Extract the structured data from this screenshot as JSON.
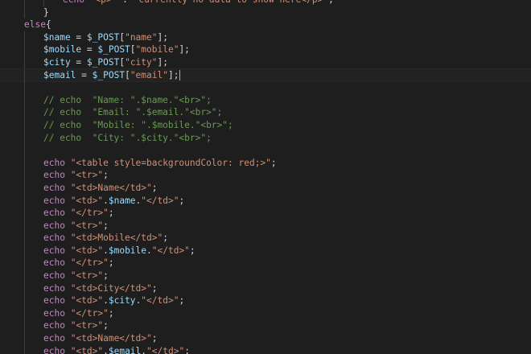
{
  "editor": {
    "current_line": 5,
    "lines": [
      {
        "indent": 2,
        "tokens": [
          [
            "kw",
            "echo "
          ],
          [
            "str",
            "\"<p>\""
          ],
          [
            "op",
            " . "
          ],
          [
            "str",
            "\"currently no data to show here</p>\""
          ],
          [
            "op",
            ";"
          ]
        ]
      },
      {
        "indent": 1,
        "tokens": [
          [
            "op",
            "}"
          ]
        ]
      },
      {
        "indent": 0,
        "tokens": [
          [
            "kw",
            "else"
          ],
          [
            "op",
            "{"
          ]
        ]
      },
      {
        "indent": 1,
        "tokens": [
          [
            "var",
            "$name"
          ],
          [
            "op",
            " = "
          ],
          [
            "var",
            "$_POST"
          ],
          [
            "op",
            "["
          ],
          [
            "str",
            "\"name\""
          ],
          [
            "op",
            "];"
          ]
        ]
      },
      {
        "indent": 1,
        "tokens": [
          [
            "var",
            "$mobile"
          ],
          [
            "op",
            " = "
          ],
          [
            "var",
            "$_POST"
          ],
          [
            "op",
            "["
          ],
          [
            "str",
            "\"mobile\""
          ],
          [
            "op",
            "];"
          ]
        ]
      },
      {
        "indent": 1,
        "tokens": [
          [
            "var",
            "$city"
          ],
          [
            "op",
            " = "
          ],
          [
            "var",
            "$_POST"
          ],
          [
            "op",
            "["
          ],
          [
            "str",
            "\"city\""
          ],
          [
            "op",
            "];"
          ]
        ]
      },
      {
        "indent": 1,
        "tokens": [
          [
            "var",
            "$email"
          ],
          [
            "op",
            " = "
          ],
          [
            "var",
            "$_POST"
          ],
          [
            "op",
            "["
          ],
          [
            "str",
            "\"email\""
          ],
          [
            "op",
            "];"
          ]
        ],
        "caret": true
      },
      {
        "indent": 1,
        "tokens": []
      },
      {
        "indent": 1,
        "tokens": [
          [
            "cm",
            "// echo  \"Name: \".$name.\"<br>\";"
          ]
        ]
      },
      {
        "indent": 1,
        "tokens": [
          [
            "cm",
            "// echo  \"Email: \".$email.\"<br>\";"
          ]
        ]
      },
      {
        "indent": 1,
        "tokens": [
          [
            "cm",
            "// echo  \"Mobile: \".$mobile.\"<br>\";"
          ]
        ]
      },
      {
        "indent": 1,
        "tokens": [
          [
            "cm",
            "// echo  \"City: \".$city.\"<br>\";"
          ]
        ]
      },
      {
        "indent": 1,
        "tokens": []
      },
      {
        "indent": 1,
        "tokens": [
          [
            "kw",
            "echo "
          ],
          [
            "str",
            "\"<table style=backgroundColor: red;>\""
          ],
          [
            "op",
            ";"
          ]
        ]
      },
      {
        "indent": 1,
        "tokens": [
          [
            "kw",
            "echo "
          ],
          [
            "str",
            "\"<tr>\""
          ],
          [
            "op",
            ";"
          ]
        ]
      },
      {
        "indent": 1,
        "tokens": [
          [
            "kw",
            "echo "
          ],
          [
            "str",
            "\"<td>Name</td>\""
          ],
          [
            "op",
            ";"
          ]
        ]
      },
      {
        "indent": 1,
        "tokens": [
          [
            "kw",
            "echo "
          ],
          [
            "str",
            "\"<td>\""
          ],
          [
            "op",
            "."
          ],
          [
            "var",
            "$name"
          ],
          [
            "op",
            "."
          ],
          [
            "str",
            "\"</td>\""
          ],
          [
            "op",
            ";"
          ]
        ]
      },
      {
        "indent": 1,
        "tokens": [
          [
            "kw",
            "echo "
          ],
          [
            "str",
            "\"</tr>\""
          ],
          [
            "op",
            ";"
          ]
        ]
      },
      {
        "indent": 1,
        "tokens": [
          [
            "kw",
            "echo "
          ],
          [
            "str",
            "\"<tr>\""
          ],
          [
            "op",
            ";"
          ]
        ]
      },
      {
        "indent": 1,
        "tokens": [
          [
            "kw",
            "echo "
          ],
          [
            "str",
            "\"<td>Mobile</td>\""
          ],
          [
            "op",
            ";"
          ]
        ]
      },
      {
        "indent": 1,
        "tokens": [
          [
            "kw",
            "echo "
          ],
          [
            "str",
            "\"<td>\""
          ],
          [
            "op",
            "."
          ],
          [
            "var",
            "$mobile"
          ],
          [
            "op",
            "."
          ],
          [
            "str",
            "\"</td>\""
          ],
          [
            "op",
            ";"
          ]
        ]
      },
      {
        "indent": 1,
        "tokens": [
          [
            "kw",
            "echo "
          ],
          [
            "str",
            "\"</tr>\""
          ],
          [
            "op",
            ";"
          ]
        ]
      },
      {
        "indent": 1,
        "tokens": [
          [
            "kw",
            "echo "
          ],
          [
            "str",
            "\"<tr>\""
          ],
          [
            "op",
            ";"
          ]
        ]
      },
      {
        "indent": 1,
        "tokens": [
          [
            "kw",
            "echo "
          ],
          [
            "str",
            "\"<td>City</td>\""
          ],
          [
            "op",
            ";"
          ]
        ]
      },
      {
        "indent": 1,
        "tokens": [
          [
            "kw",
            "echo "
          ],
          [
            "str",
            "\"<td>\""
          ],
          [
            "op",
            "."
          ],
          [
            "var",
            "$city"
          ],
          [
            "op",
            "."
          ],
          [
            "str",
            "\"</td>\""
          ],
          [
            "op",
            ";"
          ]
        ]
      },
      {
        "indent": 1,
        "tokens": [
          [
            "kw",
            "echo "
          ],
          [
            "str",
            "\"</tr>\""
          ],
          [
            "op",
            ";"
          ]
        ]
      },
      {
        "indent": 1,
        "tokens": [
          [
            "kw",
            "echo "
          ],
          [
            "str",
            "\"<tr>\""
          ],
          [
            "op",
            ";"
          ]
        ]
      },
      {
        "indent": 1,
        "tokens": [
          [
            "kw",
            "echo "
          ],
          [
            "str",
            "\"<td>Name</td>\""
          ],
          [
            "op",
            ";"
          ]
        ]
      },
      {
        "indent": 1,
        "tokens": [
          [
            "kw",
            "echo "
          ],
          [
            "str",
            "\"<td>\""
          ],
          [
            "op",
            "."
          ],
          [
            "var",
            "$email"
          ],
          [
            "op",
            "."
          ],
          [
            "str",
            "\"</td>\""
          ],
          [
            "op",
            ";"
          ]
        ]
      }
    ]
  },
  "colors": {
    "background": "#1e1e1e",
    "keyword": "#c586c0",
    "variable": "#9cdcfe",
    "string": "#ce9178",
    "comment": "#6a9955",
    "text": "#d4d4d4"
  }
}
